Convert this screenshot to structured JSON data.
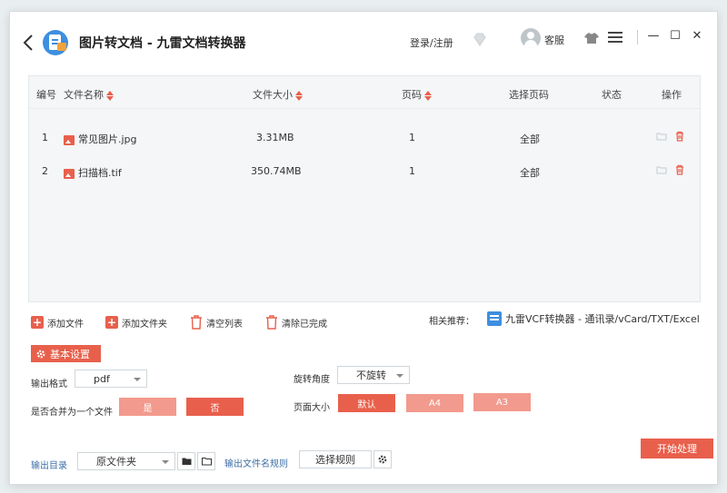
{
  "window": {
    "title": "图片转文档 - 九雷文档转换器",
    "login_label": "登录/注册",
    "service_label": "客服",
    "minimize_label": "—",
    "maximize_label": "☐",
    "close_label": "✕"
  },
  "table": {
    "headers": {
      "num": "编号",
      "name": "文件名称",
      "size": "文件大小",
      "pages": "页码",
      "select_pages": "选择页码",
      "status": "状态",
      "ops": "操作"
    },
    "rows": [
      {
        "num": "1",
        "name": "常见图片.jpg",
        "size": "3.31MB",
        "pages": "1",
        "select_pages": "全部"
      },
      {
        "num": "2",
        "name": "扫描档.tif",
        "size": "350.74MB",
        "pages": "1",
        "select_pages": "全部"
      }
    ]
  },
  "toolbar": {
    "add_file": "添加文件",
    "add_folder": "添加文件夹",
    "clear_list": "清空列表",
    "clear_done": "清除已完成",
    "recommend_label": "相关推荐：",
    "recommend_link": "九雷VCF转换器 - 通讯录/vCard/TXT/Excel"
  },
  "settings": {
    "title": "基本设置",
    "output_format_label": "输出格式",
    "output_format_value": "pdf",
    "merge_label": "是否合并为一个文件",
    "merge_yes": "是",
    "merge_no": "否",
    "rotate_label": "旋转角度",
    "rotate_value": "不旋转",
    "page_size_label": "页面大小",
    "page_size_options": [
      "默认",
      "A4",
      "A3"
    ]
  },
  "bottom": {
    "output_dir_label": "输出目录",
    "output_dir_value": "原文件夹",
    "filename_rule_label": "输出文件名规则",
    "select_rule_label": "选择规则",
    "start_label": "开始处理"
  },
  "colors": {
    "accent": "#e8604c",
    "accent_light": "#f29a8d",
    "link_blue": "#3d6fa8"
  }
}
